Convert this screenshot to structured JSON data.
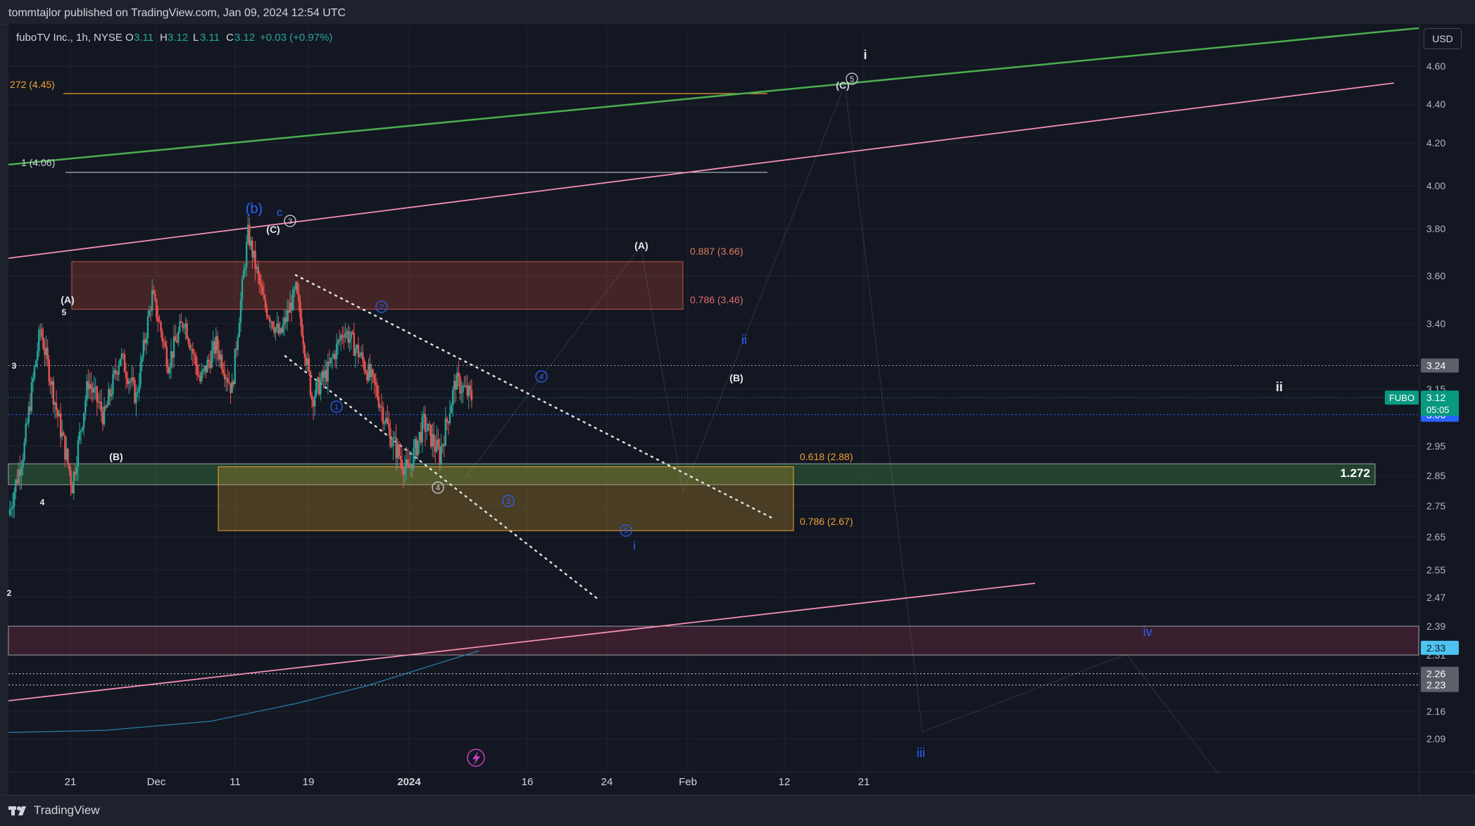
{
  "header": {
    "publish_info": "tommtajlor published on TradingView.com, Jan 09, 2024 12:54 UTC"
  },
  "legend": {
    "symbol_desc": "fuboTV Inc., 1h, NYSE",
    "o_label": "O",
    "o_value": "3.11",
    "h_label": "H",
    "h_value": "3.12",
    "l_label": "L",
    "l_value": "3.11",
    "c_label": "C",
    "c_value": "3.12",
    "change": "+0.03 (+0.97%)"
  },
  "currency": "USD",
  "footer": {
    "brand": "TradingView"
  },
  "colors": {
    "bg": "#131722",
    "up": "#26a69a",
    "down": "#ef5350",
    "grid": "#1f2430",
    "green_line": "#4caf50",
    "pink_line": "#f48fb1",
    "orange": "#f0a030",
    "blue": "#2962ff",
    "white": "#d1d4dc"
  },
  "chart_data": {
    "type": "candlestick",
    "symbol": "FUBO",
    "timeframe": "1h",
    "y_axis": {
      "range": [
        2.02,
        4.72
      ],
      "ticks": [
        4.6,
        4.4,
        4.2,
        4.0,
        3.8,
        3.6,
        3.4,
        3.15,
        2.95,
        2.85,
        2.75,
        2.65,
        2.55,
        2.47,
        2.39,
        2.31,
        2.16,
        2.09
      ]
    },
    "x_axis": {
      "ticks": [
        {
          "label": "21",
          "bold": false
        },
        {
          "label": "Dec",
          "bold": false
        },
        {
          "label": "11",
          "bold": false
        },
        {
          "label": "19",
          "bold": false
        },
        {
          "label": "2024",
          "bold": true
        },
        {
          "label": "16",
          "bold": false
        },
        {
          "label": "24",
          "bold": false
        },
        {
          "label": "Feb",
          "bold": false
        },
        {
          "label": "12",
          "bold": false
        },
        {
          "label": "21",
          "bold": false
        }
      ]
    },
    "price_path": [
      [
        2.72,
        "Nov 17"
      ],
      [
        2.95,
        "Nov 19"
      ],
      [
        3.38,
        "Nov 21"
      ],
      [
        3.08,
        "Nov 23"
      ],
      [
        2.82,
        "Nov 24"
      ],
      [
        3.18,
        "Nov 27"
      ],
      [
        3.05,
        "Nov 29"
      ],
      [
        3.28,
        "Dec 1"
      ],
      [
        3.12,
        "Dec 4"
      ],
      [
        3.52,
        "Dec 6"
      ],
      [
        3.25,
        "Dec 7"
      ],
      [
        3.42,
        "Dec 8"
      ],
      [
        3.18,
        "Dec 11"
      ],
      [
        3.32,
        "Dec 12"
      ],
      [
        3.15,
        "Dec 13"
      ],
      [
        3.78,
        "Dec 14"
      ],
      [
        3.48,
        "Dec 15"
      ],
      [
        3.35,
        "Dec 18"
      ],
      [
        3.54,
        "Dec 19"
      ],
      [
        3.12,
        "Dec 20"
      ],
      [
        3.22,
        "Dec 21"
      ],
      [
        3.38,
        "Dec 22"
      ],
      [
        3.28,
        "Dec 27"
      ],
      [
        3.15,
        "Dec 29"
      ],
      [
        2.97,
        "Jan 3"
      ],
      [
        2.86,
        "Jan 4"
      ],
      [
        3.03,
        "Jan 5"
      ],
      [
        2.92,
        "Jan 8"
      ],
      [
        3.18,
        "Jan 9"
      ],
      [
        3.12,
        "Jan 9"
      ]
    ],
    "last_price": {
      "symbol": "FUBO",
      "value": "3.12",
      "countdown": "05:05"
    },
    "price_badges": [
      {
        "value": "3.24",
        "style": "gray"
      },
      {
        "value": "3.06",
        "style": "blue"
      },
      {
        "value": "2.33",
        "style": "cyan"
      },
      {
        "value": "2.26",
        "style": "gray"
      },
      {
        "value": "2.23",
        "style": "gray"
      }
    ],
    "fib_labels": [
      {
        "text": "272 (4.45)",
        "price": 4.45
      },
      {
        "text": "1 (4.06)",
        "price": 4.06
      },
      {
        "text": "0.887 (3.66)",
        "price": 3.66
      },
      {
        "text": "0.786 (3.46)",
        "price": 3.46
      },
      {
        "text": "0.618 (2.88)",
        "price": 2.88
      },
      {
        "text": "0.786 (2.67)",
        "price": 2.67
      }
    ],
    "zones": [
      {
        "name": "upper-resistance-zone",
        "from": 3.46,
        "to": 3.66
      },
      {
        "name": "lower-fib-zone",
        "from": 2.67,
        "to": 2.88
      },
      {
        "name": "green-band-1272",
        "from": 2.82,
        "to": 2.89,
        "label": "1.272"
      },
      {
        "name": "bottom-pink-zone",
        "from": 2.31,
        "to": 2.39
      }
    ],
    "wave_labels": {
      "white": [
        "(A)",
        "5",
        "(B)",
        "4",
        "3",
        "2",
        "(C)",
        "3",
        "(A)",
        "(B)",
        "(C)",
        "5",
        "4",
        "i",
        "ii"
      ],
      "blue": [
        "(b)",
        "c",
        "1",
        "2",
        "3",
        "4",
        "5",
        "i",
        "ii",
        "iii",
        "iv"
      ]
    }
  }
}
